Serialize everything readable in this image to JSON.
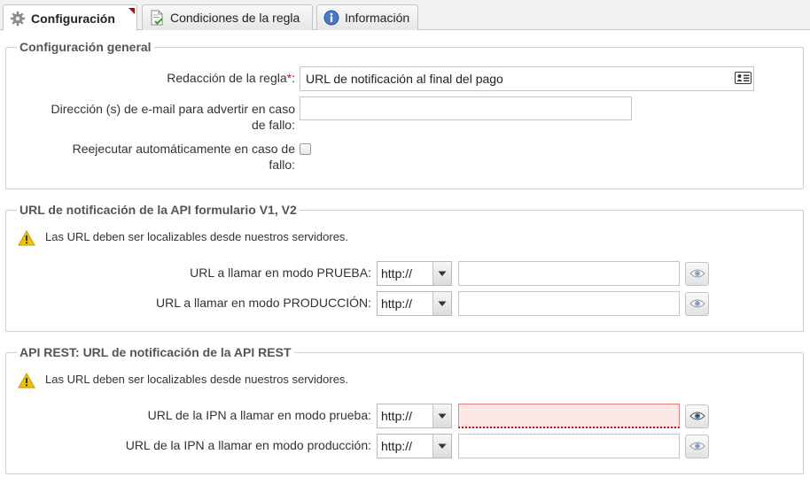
{
  "tabs": [
    {
      "label": "Configuración",
      "icon": "gear-icon",
      "active": true
    },
    {
      "label": "Condiciones de la regla",
      "icon": "document-check-icon",
      "active": false
    },
    {
      "label": "Información",
      "icon": "info-icon",
      "active": false
    }
  ],
  "general": {
    "legend": "Configuración general",
    "rule_label": "Redacción de la regla",
    "required_mark": "*",
    "rule_suffix": ":",
    "rule_value": "URL de notificación al final del pago",
    "email_label_1": "Dirección (s) de e-mail para advertir en caso",
    "email_label_2": "de fallo:",
    "email_value": "",
    "retry_label_1": "Reejecutar automáticamente en caso de",
    "retry_label_2": "fallo:",
    "retry_checked": false
  },
  "api_form": {
    "legend": "URL de notificación de la API formulario V1, V2",
    "warning": "Las URL deben ser localizables desde nuestros servidores.",
    "test_label": "URL a llamar en modo PRUEBA:",
    "test_protocol": "http://",
    "test_value": "",
    "prod_label": "URL a llamar en modo PRODUCCIÓN:",
    "prod_protocol": "http://",
    "prod_value": ""
  },
  "api_rest": {
    "legend": "API REST: URL de notificación de la API REST",
    "warning": "Las URL deben ser localizables desde nuestros servidores.",
    "test_label": "URL de la IPN a llamar en modo prueba:",
    "test_protocol": "http://",
    "test_value": "",
    "prod_label": "URL de la IPN a llamar en modo producción:",
    "prod_protocol": "http://",
    "prod_value": ""
  },
  "colors": {
    "required": "#ee0000",
    "error_border": "#e00000",
    "error_bg": "#fde8e8",
    "tab_marker": "#c00000",
    "warning": "#f2c200"
  }
}
